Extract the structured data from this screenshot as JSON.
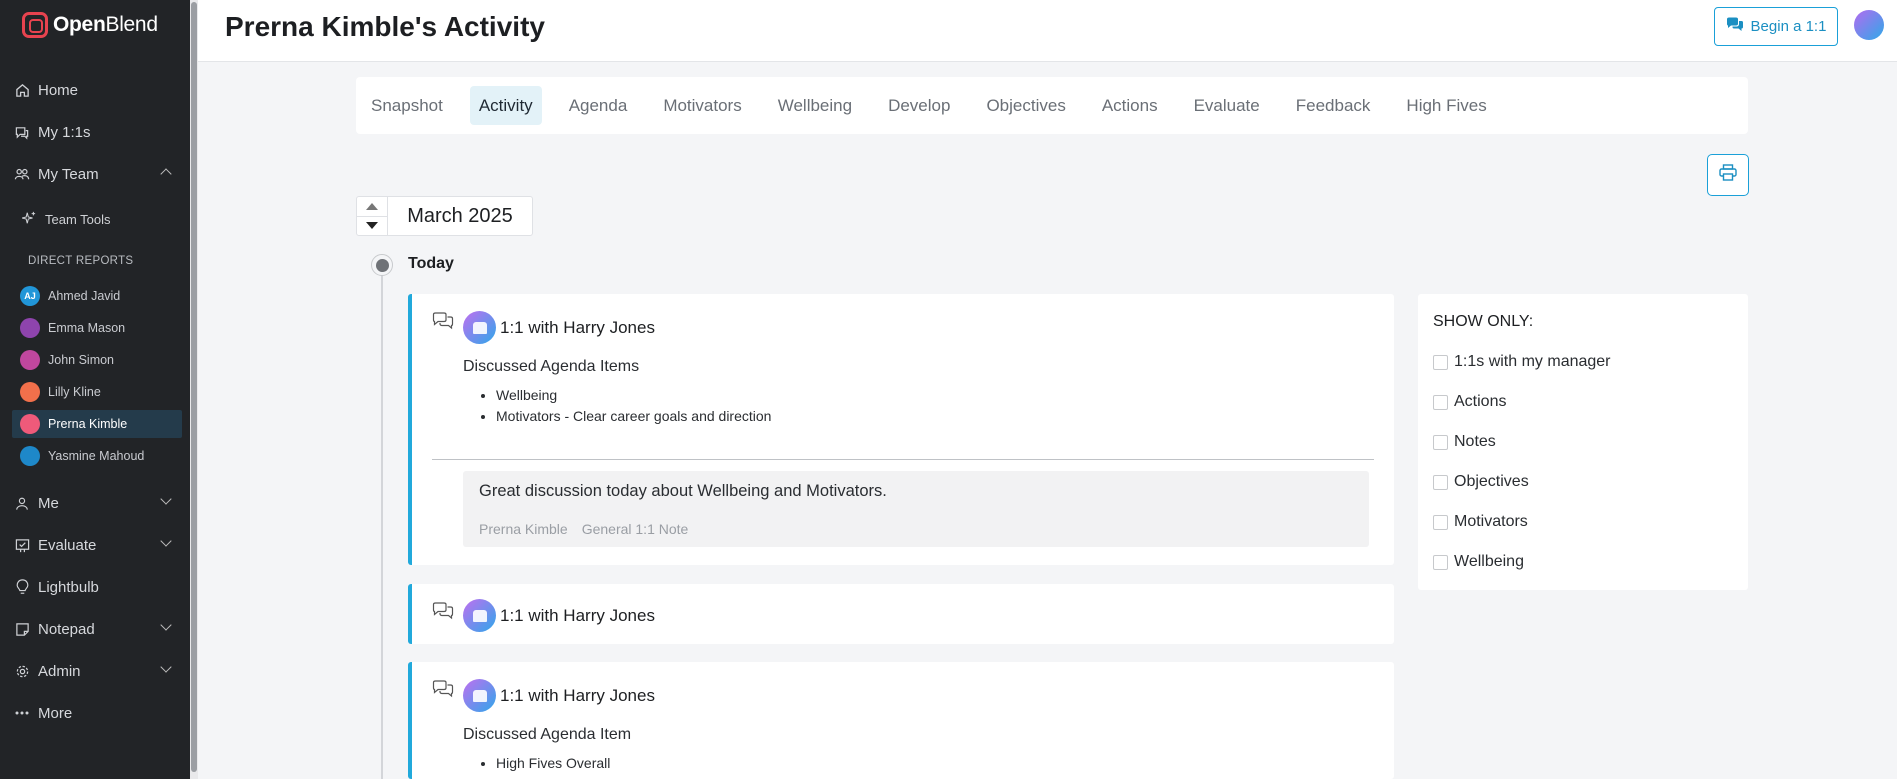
{
  "brand": {
    "name_bold": "Open",
    "name_light": "Blend"
  },
  "sidebar": {
    "nav": [
      {
        "label": "Home",
        "icon": "home-icon"
      },
      {
        "label": "My 1:1s",
        "icon": "chat-icon"
      },
      {
        "label": "My Team",
        "icon": "team-icon",
        "expanded": true
      }
    ],
    "team_tools": {
      "label": "Team Tools",
      "icon": "sparkle-icon"
    },
    "direct_reports_label": "DIRECT REPORTS",
    "reports": [
      {
        "name": "Ahmed Javid",
        "initials": "AJ",
        "color": "#2196d8"
      },
      {
        "name": "Emma Mason",
        "initials": "",
        "color": "#8e44ad"
      },
      {
        "name": "John Simon",
        "initials": "",
        "color": "#c0479e"
      },
      {
        "name": "Lilly Kline",
        "initials": "",
        "color": "#f2704b"
      },
      {
        "name": "Prerna Kimble",
        "initials": "",
        "color": "#ef5a7a",
        "active": true
      },
      {
        "name": "Yasmine Mahoud",
        "initials": "",
        "color": "#1e88c9"
      }
    ],
    "lower_nav": [
      {
        "label": "Me",
        "icon": "person-icon",
        "chevron": true
      },
      {
        "label": "Evaluate",
        "icon": "evaluate-icon",
        "chevron": true
      },
      {
        "label": "Lightbulb",
        "icon": "lightbulb-icon",
        "chevron": false
      },
      {
        "label": "Notepad",
        "icon": "notepad-icon",
        "chevron": true
      },
      {
        "label": "Admin",
        "icon": "gear-icon",
        "chevron": true
      },
      {
        "label": "More",
        "icon": "ellipsis-icon",
        "chevron": false
      }
    ]
  },
  "header": {
    "title": "Prerna Kimble's Activity",
    "begin_button": "Begin a 1:1"
  },
  "tabs": [
    "Snapshot",
    "Activity",
    "Agenda",
    "Motivators",
    "Wellbeing",
    "Develop",
    "Objectives",
    "Actions",
    "Evaluate",
    "Feedback",
    "High Fives"
  ],
  "active_tab": "Activity",
  "month": "March 2025",
  "timeline": {
    "today_label": "Today",
    "cards": [
      {
        "title": "1:1 with Harry Jones",
        "subtitle": "Discussed Agenda Items",
        "items": [
          "Wellbeing",
          "Motivators - Clear career goals and direction"
        ],
        "note": {
          "text": "Great discussion today about Wellbeing and Motivators.",
          "author": "Prerna Kimble",
          "type": "General 1:1 Note"
        }
      },
      {
        "title": "1:1 with Harry Jones"
      },
      {
        "title": "1:1 with Harry Jones",
        "subtitle": "Discussed Agenda Item",
        "items": [
          "High Fives Overall"
        ]
      }
    ]
  },
  "filters": {
    "title": "SHOW ONLY:",
    "options": [
      "1:1s with my manager",
      "Actions",
      "Notes",
      "Objectives",
      "Motivators",
      "Wellbeing"
    ]
  },
  "colors": {
    "accent": "#21a9db",
    "sidebar_bg": "#222427",
    "active_report_bg": "#243b4b",
    "brand_red": "#e8434f"
  }
}
